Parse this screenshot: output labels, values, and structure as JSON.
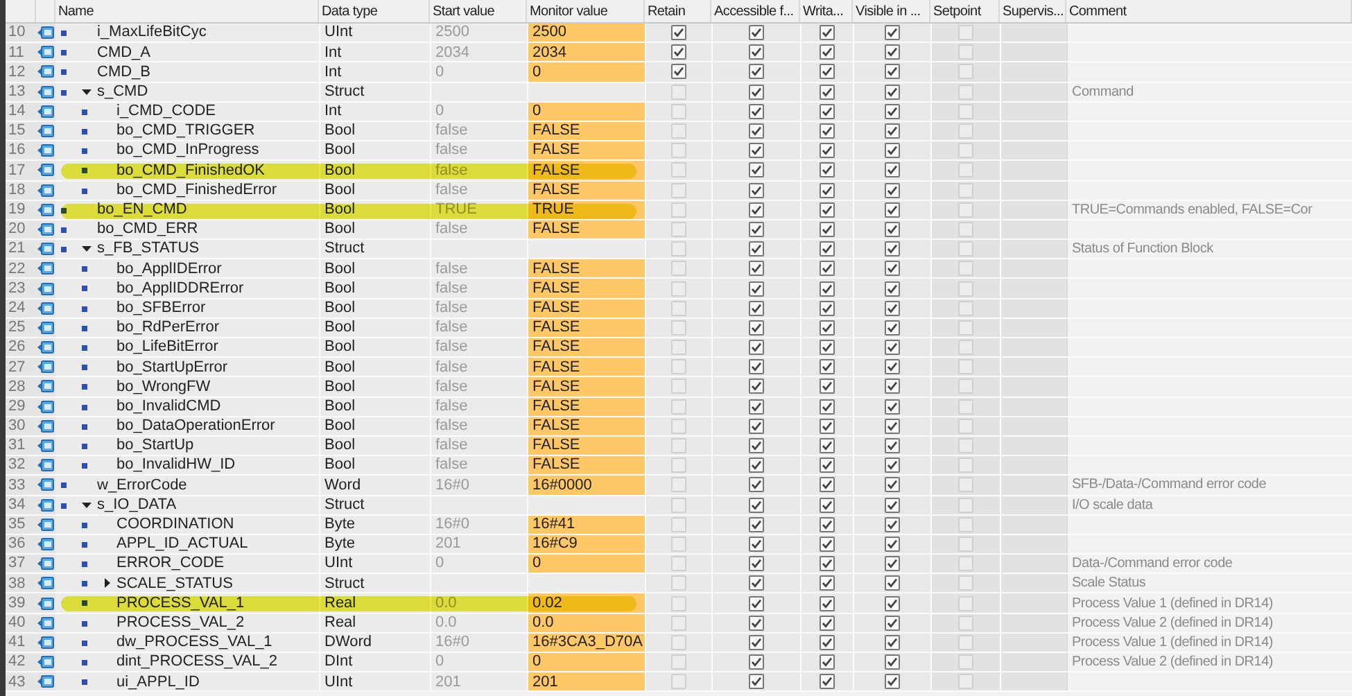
{
  "columns": [
    "Name",
    "Data type",
    "Start value",
    "Monitor value",
    "Retain",
    "Accessible f...",
    "Writa...",
    "Visible in ...",
    "Setpoint",
    "Supervis...",
    "Comment"
  ],
  "rows": [
    {
      "number": "10",
      "name": "i_MaxLifeBitCyc",
      "data_type": "UInt",
      "start_value": "2500",
      "monitor_value": "2500",
      "retain": true,
      "accessible": true,
      "writable": true,
      "visible": true,
      "setpoint": false,
      "highlighted": false
    },
    {
      "number": "11",
      "name": "CMD_A",
      "data_type": "Int",
      "start_value": "2034",
      "monitor_value": "2034",
      "retain": true,
      "accessible": true,
      "writable": true,
      "visible": true,
      "setpoint": false,
      "highlighted": false
    },
    {
      "number": "12",
      "name": "CMD_B",
      "data_type": "Int",
      "start_value": "0",
      "monitor_value": "0",
      "retain": true,
      "accessible": true,
      "writable": true,
      "visible": true,
      "setpoint": false,
      "highlighted": false
    },
    {
      "number": "13",
      "name": "s_CMD",
      "data_type": "Struct",
      "expanded": true,
      "retain": false,
      "accessible": true,
      "writable": true,
      "visible": true,
      "setpoint": false,
      "highlighted": false,
      "comment": "Command",
      "children": [
        {
          "number": "14",
          "name": "i_CMD_CODE",
          "data_type": "Int",
          "start_value": "0",
          "monitor_value": "0",
          "retain": false,
          "accessible": true,
          "writable": true,
          "visible": true,
          "setpoint": false,
          "highlighted": false
        },
        {
          "number": "15",
          "name": "bo_CMD_TRIGGER",
          "data_type": "Bool",
          "start_value": "false",
          "monitor_value": "FALSE",
          "retain": false,
          "accessible": true,
          "writable": true,
          "visible": true,
          "setpoint": false,
          "highlighted": false
        },
        {
          "number": "16",
          "name": "bo_CMD_InProgress",
          "data_type": "Bool",
          "start_value": "false",
          "monitor_value": "FALSE",
          "retain": false,
          "accessible": true,
          "writable": true,
          "visible": true,
          "setpoint": false,
          "highlighted": false
        },
        {
          "number": "17",
          "name": "bo_CMD_FinishedOK",
          "data_type": "Bool",
          "start_value": "false",
          "monitor_value": "FALSE",
          "retain": false,
          "accessible": true,
          "writable": true,
          "visible": true,
          "setpoint": false,
          "highlighted": true
        },
        {
          "number": "18",
          "name": "bo_CMD_FinishedError",
          "data_type": "Bool",
          "start_value": "false",
          "monitor_value": "FALSE",
          "retain": false,
          "accessible": true,
          "writable": true,
          "visible": true,
          "setpoint": false,
          "highlighted": false
        }
      ]
    },
    {
      "number": "19",
      "name": "bo_EN_CMD",
      "data_type": "Bool",
      "start_value": "TRUE",
      "monitor_value": "TRUE",
      "retain": false,
      "accessible": true,
      "writable": true,
      "visible": true,
      "setpoint": false,
      "highlighted": true,
      "comment": "TRUE=Commands enabled, FALSE=Cor"
    },
    {
      "number": "20",
      "name": "bo_CMD_ERR",
      "data_type": "Bool",
      "start_value": "false",
      "monitor_value": "FALSE",
      "retain": false,
      "accessible": true,
      "writable": true,
      "visible": true,
      "setpoint": false,
      "highlighted": false
    },
    {
      "number": "21",
      "name": "s_FB_STATUS",
      "data_type": "Struct",
      "expanded": true,
      "retain": false,
      "accessible": true,
      "writable": true,
      "visible": true,
      "setpoint": false,
      "highlighted": false,
      "comment": "Status of Function Block",
      "children": [
        {
          "number": "22",
          "name": "bo_ApplIDError",
          "data_type": "Bool",
          "start_value": "false",
          "monitor_value": "FALSE",
          "retain": false,
          "accessible": true,
          "writable": true,
          "visible": true,
          "setpoint": false,
          "highlighted": false
        },
        {
          "number": "23",
          "name": "bo_ApplIDDRError",
          "data_type": "Bool",
          "start_value": "false",
          "monitor_value": "FALSE",
          "retain": false,
          "accessible": true,
          "writable": true,
          "visible": true,
          "setpoint": false,
          "highlighted": false
        },
        {
          "number": "24",
          "name": "bo_SFBError",
          "data_type": "Bool",
          "start_value": "false",
          "monitor_value": "FALSE",
          "retain": false,
          "accessible": true,
          "writable": true,
          "visible": true,
          "setpoint": false,
          "highlighted": false
        },
        {
          "number": "25",
          "name": "bo_RdPerError",
          "data_type": "Bool",
          "start_value": "false",
          "monitor_value": "FALSE",
          "retain": false,
          "accessible": true,
          "writable": true,
          "visible": true,
          "setpoint": false,
          "highlighted": false
        },
        {
          "number": "26",
          "name": "bo_LifeBitError",
          "data_type": "Bool",
          "start_value": "false",
          "monitor_value": "FALSE",
          "retain": false,
          "accessible": true,
          "writable": true,
          "visible": true,
          "setpoint": false,
          "highlighted": false
        },
        {
          "number": "27",
          "name": "bo_StartUpError",
          "data_type": "Bool",
          "start_value": "false",
          "monitor_value": "FALSE",
          "retain": false,
          "accessible": true,
          "writable": true,
          "visible": true,
          "setpoint": false,
          "highlighted": false
        },
        {
          "number": "28",
          "name": "bo_WrongFW",
          "data_type": "Bool",
          "start_value": "false",
          "monitor_value": "FALSE",
          "retain": false,
          "accessible": true,
          "writable": true,
          "visible": true,
          "setpoint": false,
          "highlighted": false
        },
        {
          "number": "29",
          "name": "bo_InvalidCMD",
          "data_type": "Bool",
          "start_value": "false",
          "monitor_value": "FALSE",
          "retain": false,
          "accessible": true,
          "writable": true,
          "visible": true,
          "setpoint": false,
          "highlighted": false
        },
        {
          "number": "30",
          "name": "bo_DataOperationError",
          "data_type": "Bool",
          "start_value": "false",
          "monitor_value": "FALSE",
          "retain": false,
          "accessible": true,
          "writable": true,
          "visible": true,
          "setpoint": false,
          "highlighted": false
        },
        {
          "number": "31",
          "name": "bo_StartUp",
          "data_type": "Bool",
          "start_value": "false",
          "monitor_value": "FALSE",
          "retain": false,
          "accessible": true,
          "writable": true,
          "visible": true,
          "setpoint": false,
          "highlighted": false
        },
        {
          "number": "32",
          "name": "bo_InvalidHW_ID",
          "data_type": "Bool",
          "start_value": "false",
          "monitor_value": "FALSE",
          "retain": false,
          "accessible": true,
          "writable": true,
          "visible": true,
          "setpoint": false,
          "highlighted": false
        }
      ]
    },
    {
      "number": "33",
      "name": "w_ErrorCode",
      "data_type": "Word",
      "start_value": "16#0",
      "monitor_value": "16#0000",
      "retain": false,
      "accessible": true,
      "writable": true,
      "visible": true,
      "setpoint": false,
      "highlighted": false,
      "comment": "SFB-/Data-/Command error code"
    },
    {
      "number": "34",
      "name": "s_IO_DATA",
      "data_type": "Struct",
      "expanded": true,
      "retain": false,
      "accessible": true,
      "writable": true,
      "visible": true,
      "setpoint": false,
      "highlighted": false,
      "comment": "I/O scale data",
      "children": [
        {
          "number": "35",
          "name": "COORDINATION",
          "data_type": "Byte",
          "start_value": "16#0",
          "monitor_value": "16#41",
          "retain": false,
          "accessible": true,
          "writable": true,
          "visible": true,
          "setpoint": false,
          "highlighted": false
        },
        {
          "number": "36",
          "name": "APPL_ID_ACTUAL",
          "data_type": "Byte",
          "start_value": "201",
          "monitor_value": "16#C9",
          "retain": false,
          "accessible": true,
          "writable": true,
          "visible": true,
          "setpoint": false,
          "highlighted": false
        },
        {
          "number": "37",
          "name": "ERROR_CODE",
          "data_type": "UInt",
          "start_value": "0",
          "monitor_value": "0",
          "retain": false,
          "accessible": true,
          "writable": true,
          "visible": true,
          "setpoint": false,
          "highlighted": false,
          "comment": "Data-/Command error code"
        },
        {
          "number": "38",
          "name": "SCALE_STATUS",
          "data_type": "Struct",
          "expanded": false,
          "retain": false,
          "accessible": true,
          "writable": true,
          "visible": true,
          "setpoint": false,
          "highlighted": false,
          "comment": "Scale Status"
        },
        {
          "number": "39",
          "name": "PROCESS_VAL_1",
          "data_type": "Real",
          "start_value": "0.0",
          "monitor_value": "0.02",
          "retain": false,
          "accessible": true,
          "writable": true,
          "visible": true,
          "setpoint": false,
          "highlighted": true,
          "comment": "Process Value 1 (defined in DR14)"
        },
        {
          "number": "40",
          "name": "PROCESS_VAL_2",
          "data_type": "Real",
          "start_value": "0.0",
          "monitor_value": "0.0",
          "retain": false,
          "accessible": true,
          "writable": true,
          "visible": true,
          "setpoint": false,
          "highlighted": false,
          "comment": "Process Value 2 (defined in DR14)"
        },
        {
          "number": "41",
          "name": "dw_PROCESS_VAL_1",
          "data_type": "DWord",
          "start_value": "16#0",
          "monitor_value": "16#3CA3_D70A",
          "retain": false,
          "accessible": true,
          "writable": true,
          "visible": true,
          "setpoint": false,
          "highlighted": false,
          "comment": "Process Value 1 (defined in DR14)"
        },
        {
          "number": "42",
          "name": "dint_PROCESS_VAL_2",
          "data_type": "DInt",
          "start_value": "0",
          "monitor_value": "0",
          "retain": false,
          "accessible": true,
          "writable": true,
          "visible": true,
          "setpoint": false,
          "highlighted": false,
          "comment": "Process Value 2 (defined in DR14)"
        },
        {
          "number": "43",
          "name": "ui_APPL_ID",
          "data_type": "UInt",
          "start_value": "201",
          "monitor_value": "201",
          "retain": false,
          "accessible": true,
          "writable": true,
          "visible": true,
          "setpoint": false,
          "highlighted": false
        }
      ]
    }
  ]
}
